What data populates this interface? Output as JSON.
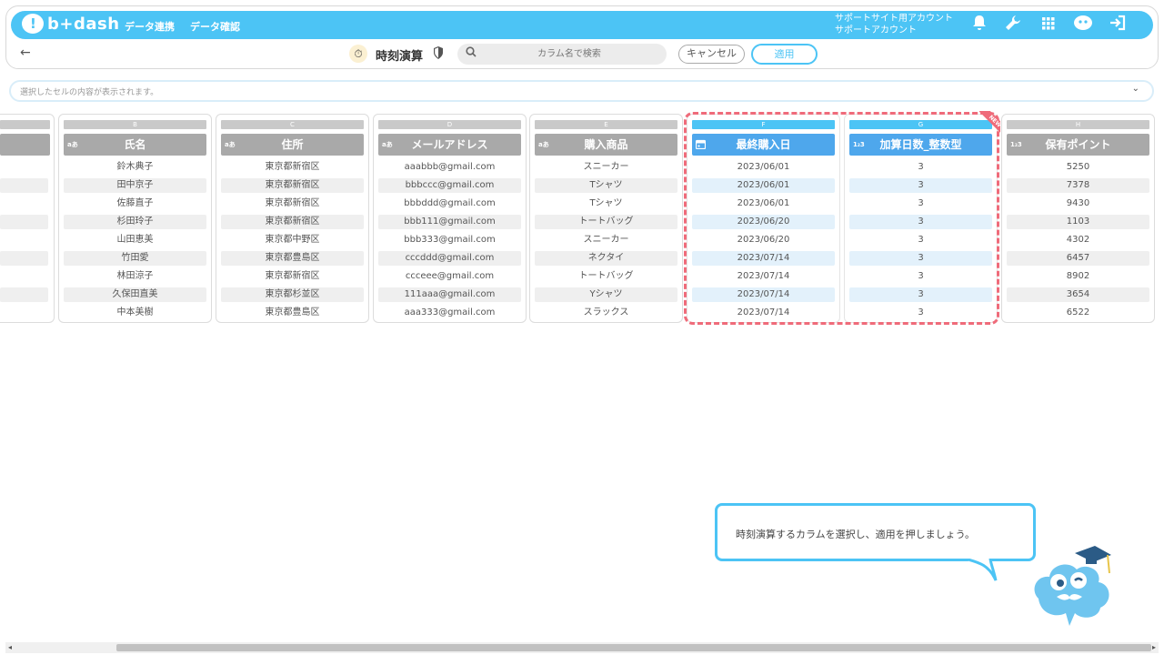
{
  "app": {
    "brand": "b+dash"
  },
  "nav": {
    "links": [
      "データ連携",
      "データ確認"
    ],
    "account_line1": "サポートサイト用アカウント",
    "account_line2": "サポートアカウント",
    "icons": [
      "bell-icon",
      "wrench-icon",
      "grid-icon",
      "mascot-icon",
      "logout-icon"
    ]
  },
  "toolbar": {
    "back_label": "←",
    "title": "時刻演算",
    "search_placeholder": "カラム名で検索",
    "cancel_label": "キャンセル",
    "apply_label": "適用"
  },
  "cellbar": {
    "placeholder": "選択したセルの内容が表示されます。"
  },
  "columns": [
    {
      "letter": "B",
      "name": "氏名",
      "type": "text",
      "cells": [
        "鈴木典子",
        "田中京子",
        "佐藤直子",
        "杉田玲子",
        "山田恵美",
        "竹田愛",
        "林田涼子",
        "久保田直美",
        "中本美樹"
      ]
    },
    {
      "letter": "C",
      "name": "住所",
      "type": "text",
      "cells": [
        "東京都新宿区",
        "東京都新宿区",
        "東京都新宿区",
        "東京都新宿区",
        "東京都中野区",
        "東京都豊島区",
        "東京都新宿区",
        "東京都杉並区",
        "東京都豊島区"
      ]
    },
    {
      "letter": "D",
      "name": "メールアドレス",
      "type": "text",
      "cells": [
        "aaabbb@gmail.com",
        "bbbccc@gmail.com",
        "bbbddd@gmail.com",
        "bbb111@gmail.com",
        "bbb333@gmail.com",
        "cccddd@gmail.com",
        "ccceee@gmail.com",
        "111aaa@gmail.com",
        "aaa333@gmail.com"
      ]
    },
    {
      "letter": "E",
      "name": "購入商品",
      "type": "text",
      "cells": [
        "スニーカー",
        "Tシャツ",
        "Tシャツ",
        "トートバッグ",
        "スニーカー",
        "ネクタイ",
        "トートバッグ",
        "Yシャツ",
        "スラックス"
      ]
    },
    {
      "letter": "F",
      "name": "最終購入日",
      "type": "date",
      "cells": [
        "2023/06/01",
        "2023/06/01",
        "2023/06/01",
        "2023/06/20",
        "2023/06/20",
        "2023/07/14",
        "2023/07/14",
        "2023/07/14",
        "2023/07/14"
      ]
    },
    {
      "letter": "G",
      "name": "加算日数_整数型",
      "type": "number",
      "cells": [
        "3",
        "3",
        "3",
        "3",
        "3",
        "3",
        "3",
        "3",
        "3"
      ]
    },
    {
      "letter": "H",
      "name": "保有ポイント",
      "type": "number",
      "cells": [
        "5250",
        "7378",
        "9430",
        "1103",
        "4302",
        "6457",
        "8902",
        "3654",
        "6522"
      ]
    }
  ],
  "type_icons": {
    "text": "aあ",
    "number": "1₂3",
    "date": "📅"
  },
  "new_badge": "NEW",
  "tutorial": {
    "message": "時刻演算するカラムを選択し、適用を押しましょう。"
  },
  "colors": {
    "accent": "#4cc4f5",
    "selected_header": "#4ea7ec",
    "highlight": "#ef6b7a"
  }
}
